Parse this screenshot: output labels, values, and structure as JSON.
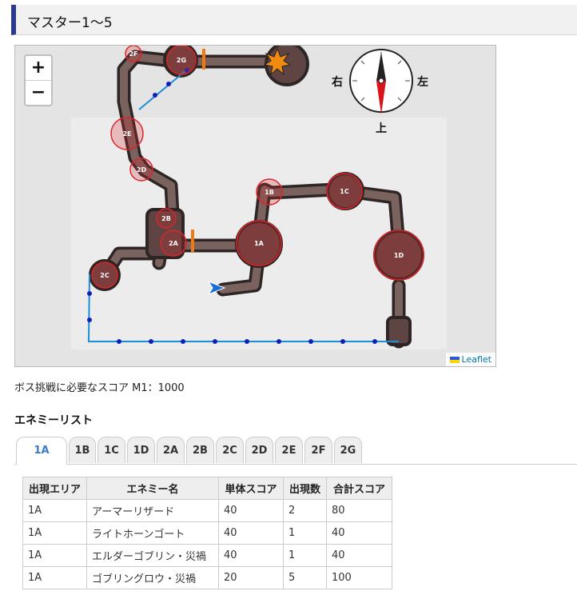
{
  "title": "マスター1〜5",
  "map": {
    "zoom_in": "+",
    "zoom_out": "−",
    "attribution": "Leaflet",
    "compass": {
      "right_label": "右",
      "left_label": "左",
      "up_label": "上"
    },
    "areas": [
      "2F",
      "2G",
      "2E",
      "2D",
      "2B",
      "2A",
      "2C",
      "1B",
      "1C",
      "1A",
      "1D"
    ]
  },
  "boss_score_text": "ボス挑戦に必要なスコア M1：1000",
  "enemy_list_heading": "エネミーリスト",
  "tabs": [
    "1A",
    "1B",
    "1C",
    "1D",
    "2A",
    "2B",
    "2C",
    "2D",
    "2E",
    "2F",
    "2G"
  ],
  "active_tab": "1A",
  "table": {
    "headers": [
      "出現エリア",
      "エネミー名",
      "単体スコア",
      "出現数",
      "合計スコア"
    ],
    "rows": [
      [
        "1A",
        "アーマーリザード",
        "40",
        "2",
        "80"
      ],
      [
        "1A",
        "ライトホーンゴート",
        "40",
        "1",
        "40"
      ],
      [
        "1A",
        "エルダーゴブリン・災禍",
        "40",
        "1",
        "40"
      ],
      [
        "1A",
        "ゴブリングロウ・災禍",
        "20",
        "5",
        "100"
      ]
    ]
  },
  "colors": {
    "accent": "#2b3a8c",
    "tab_active": "#3a78c9",
    "route": "#1a8fd8",
    "area_red": "#d9262c"
  }
}
